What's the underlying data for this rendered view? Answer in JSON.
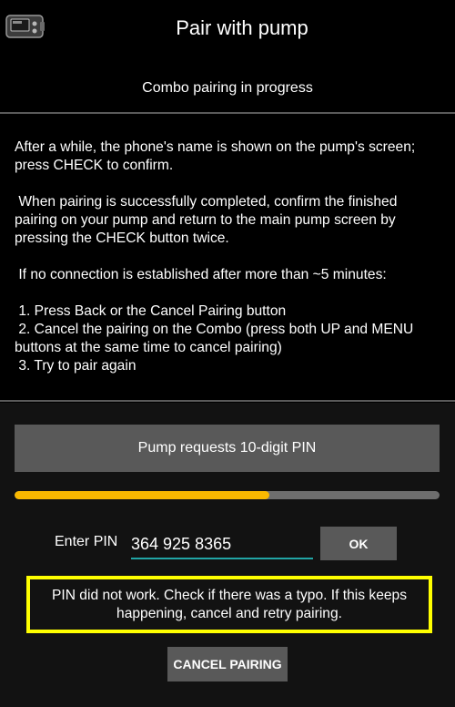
{
  "appbar": {
    "title": "Pair with pump",
    "icon": "pump-device-icon"
  },
  "status": {
    "text": "Combo pairing in progress"
  },
  "instructions": {
    "p1": "After a while, the phone's name is shown on the pump's screen; press CHECK to confirm.",
    "p2": " When pairing is successfully completed, confirm the finished pairing on your pump and return to the main pump screen by pressing the CHECK button twice.",
    "p3": " If no connection is established after more than ~5 minutes:",
    "step1": " 1. Press Back or the Cancel Pairing button",
    "step2": " 2. Cancel the pairing on the Combo (press both UP and MENU buttons at the same time to cancel pairing)",
    "step3": " 3. Try to pair again"
  },
  "pin": {
    "banner": "Pump requests 10-digit PIN",
    "progress_percent": 60,
    "label": "Enter PIN",
    "value": "364 925 8365",
    "ok_label": "OK",
    "error": "PIN did not work. Check if there was a typo. If this keeps happening, cancel and retry pairing."
  },
  "cancel_label": "CANCEL PAIRING",
  "colors": {
    "background": "#000000",
    "accent_progress": "#f9b800",
    "input_underline": "#21a5a5",
    "error_border": "#ffff00",
    "button": "#595959"
  }
}
